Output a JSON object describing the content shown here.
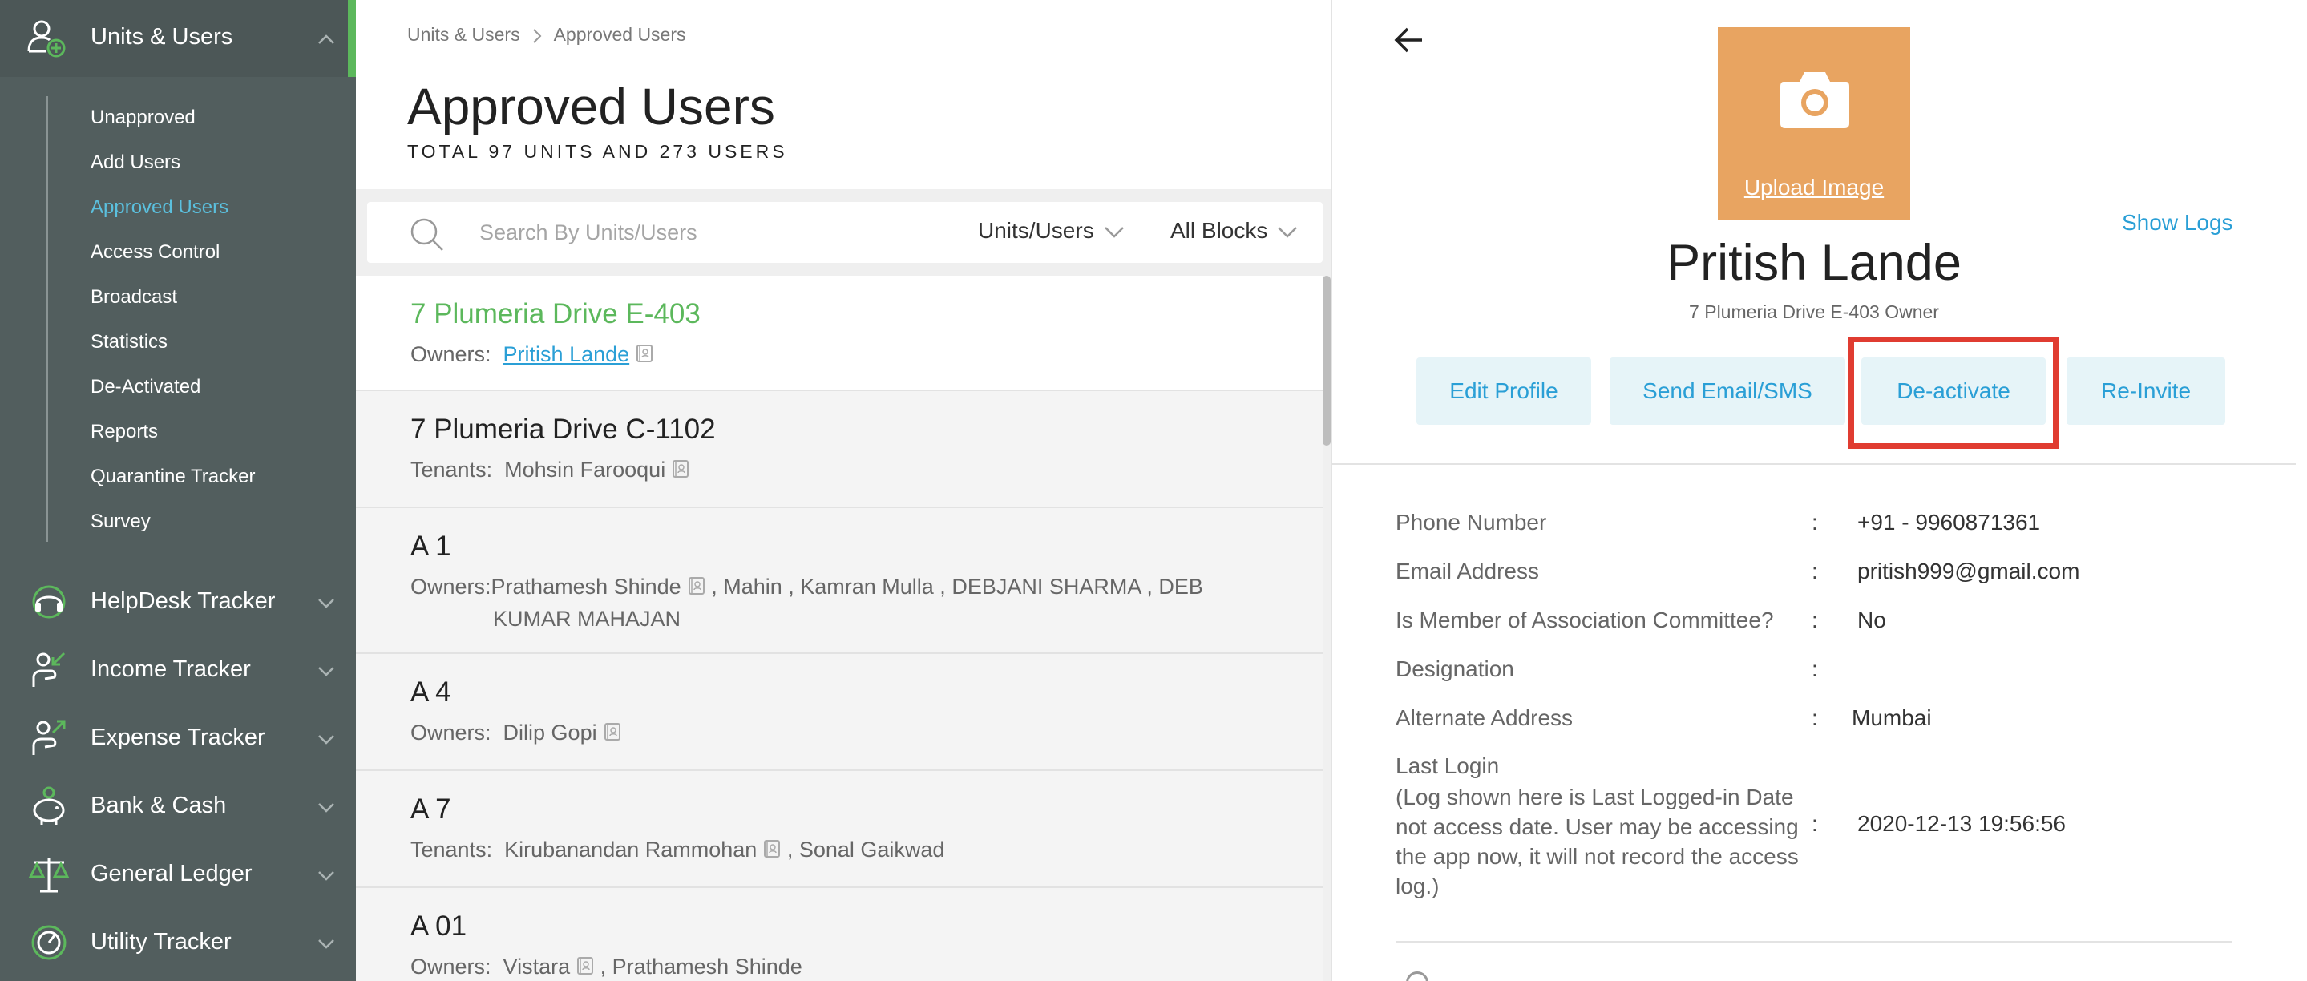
{
  "sidebar": {
    "active_section": {
      "label": "Units & Users",
      "icon": "users-add-icon"
    },
    "sub_items": [
      {
        "label": "Unapproved"
      },
      {
        "label": "Add Users"
      },
      {
        "label": "Approved Users",
        "active": true
      },
      {
        "label": "Access Control"
      },
      {
        "label": "Broadcast"
      },
      {
        "label": "Statistics"
      },
      {
        "label": "De-Activated"
      },
      {
        "label": "Reports"
      },
      {
        "label": "Quarantine Tracker"
      },
      {
        "label": "Survey"
      }
    ],
    "sections": [
      {
        "label": "HelpDesk Tracker",
        "icon": "headset-icon"
      },
      {
        "label": "Income Tracker",
        "icon": "income-icon"
      },
      {
        "label": "Expense Tracker",
        "icon": "expense-icon"
      },
      {
        "label": "Bank & Cash",
        "icon": "piggy-bank-icon"
      },
      {
        "label": "General Ledger",
        "icon": "scales-icon"
      },
      {
        "label": "Utility Tracker",
        "icon": "gauge-icon"
      }
    ],
    "colors": {
      "bg": "#525e5e",
      "accent": "#5cb85c",
      "active_link": "#5bc0de"
    }
  },
  "main": {
    "breadcrumb": [
      "Units & Users",
      "Approved Users"
    ],
    "title": "Approved Users",
    "subtitle": "TOTAL 97 UNITS AND 273 USERS",
    "search": {
      "placeholder": "Search By Units/Users",
      "value": ""
    },
    "filters": {
      "type": "Units/Users",
      "block": "All Blocks"
    },
    "units": [
      {
        "name": "7 Plumeria Drive E-403",
        "role_label": "Owners:",
        "members": "Pritish Lande",
        "selected": true
      },
      {
        "name": "7 Plumeria Drive C-1102",
        "role_label": "Tenants:",
        "members": "Mohsin Farooqui"
      },
      {
        "name": "A 1",
        "role_label": "Owners:",
        "line1_first": "Prathamesh Shinde",
        "line1_rest": ", Mahin , Kamran Mulla , DEBJANI SHARMA , DEB",
        "line2": "KUMAR MAHAJAN"
      },
      {
        "name": "A 4",
        "role_label": "Owners:",
        "members": "Dilip Gopi"
      },
      {
        "name": "A 7",
        "role_label": "Tenants:",
        "line1_first": "Kirubanandan Rammohan",
        "line1_rest": ", Sonal Gaikwad"
      },
      {
        "name": "A 01",
        "role_label": "Owners:",
        "line1_first": "Vistara",
        "line1_rest": ", Prathamesh Shinde"
      }
    ]
  },
  "profile": {
    "upload_label": "Upload Image",
    "show_logs": "Show Logs",
    "name": "Pritish Lande",
    "unit_role": "7 Plumeria Drive E-403 Owner",
    "buttons": {
      "edit": "Edit Profile",
      "send": "Send Email/SMS",
      "deactivate": "De-activate",
      "reinvite": "Re-Invite"
    },
    "details": [
      {
        "label": "Phone Number",
        "value": "+91 - 9960871361"
      },
      {
        "label": "Email Address",
        "value": "pritish999@gmail.com"
      },
      {
        "label": "Is Member of Association Committee?",
        "value": "No"
      },
      {
        "label": "Designation",
        "value": ""
      },
      {
        "label": "Alternate Address",
        "value": "Mumbai"
      }
    ],
    "last_login": {
      "label": "Last Login",
      "note": "(Log shown here is Last Logged-in Date not access date. User may be accessing the app now, it will not record the access log.)",
      "value": "2020-12-13 19:56:56"
    },
    "colors": {
      "upload_bg": "#e8a461",
      "link": "#2a9fd6",
      "button_bg": "#e6f4f8",
      "highlight": "#e03c31"
    }
  }
}
